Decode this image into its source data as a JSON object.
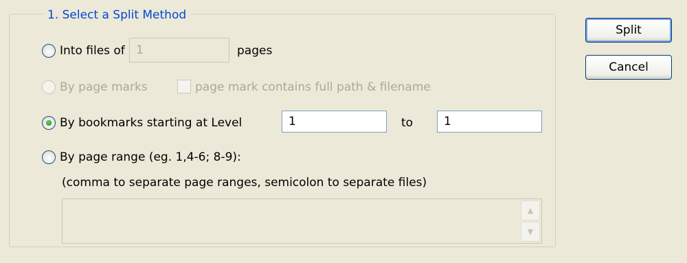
{
  "group": {
    "title": "1. Select a Split Method"
  },
  "buttons": {
    "split": "Split",
    "cancel": "Cancel"
  },
  "options": {
    "files": {
      "label": "Into files of",
      "value": "1",
      "suffix": "pages",
      "selected": false
    },
    "page_marks": {
      "label": "By page marks",
      "checkbox_label": "page mark contains full path & filename",
      "enabled": false,
      "checked": false
    },
    "bookmarks": {
      "label": "By bookmarks starting at Level",
      "from_value": "1",
      "to_label": "to",
      "to_value": "1",
      "selected": true
    },
    "page_range": {
      "label": "By page range (eg. 1,4-6; 8-9):",
      "hint": "(comma to separate page ranges, semicolon to separate files)",
      "value": "",
      "selected": false
    }
  },
  "icons": {
    "scroll_up": "scroll-up-icon",
    "scroll_down": "scroll-down-icon"
  },
  "colors": {
    "legend_text": "#0046d5",
    "disabled_text": "#aca899",
    "selected_dot": "#21a121",
    "window_bg": "#ece9d8"
  }
}
